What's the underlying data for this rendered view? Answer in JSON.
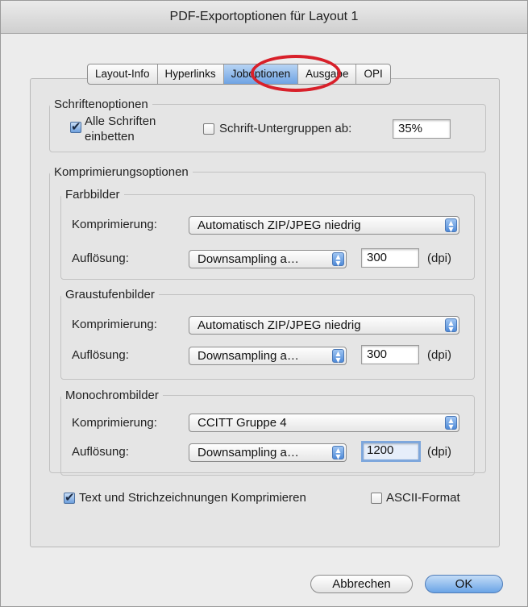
{
  "window": {
    "title": "PDF-Exportoptionen für Layout 1"
  },
  "tabs": [
    "Layout-Info",
    "Hyperlinks",
    "Joboptionen",
    "Ausgabe",
    "OPI"
  ],
  "fonts": {
    "legend": "Schriftenoptionen",
    "embed_all_line1": "Alle Schriften",
    "embed_all_line2": "einbetten",
    "embed_all_checked": true,
    "subset_label": "Schrift-Untergruppen ab:",
    "subset_checked": false,
    "subset_value": "35%"
  },
  "compression": {
    "legend": "Komprimierungsoptionen",
    "color": {
      "legend": "Farbbilder",
      "compression_label": "Komprimierung:",
      "compression_value": "Automatisch ZIP/JPEG niedrig",
      "resolution_label": "Auflösung:",
      "resolution_mode": "Downsampling a…",
      "dpi_value": "300",
      "dpi_unit": "(dpi)"
    },
    "gray": {
      "legend": "Graustufenbilder",
      "compression_label": "Komprimierung:",
      "compression_value": "Automatisch ZIP/JPEG niedrig",
      "resolution_label": "Auflösung:",
      "resolution_mode": "Downsampling a…",
      "dpi_value": "300",
      "dpi_unit": "(dpi)"
    },
    "mono": {
      "legend": "Monochrombilder",
      "compression_label": "Komprimierung:",
      "compression_value": "CCITT Gruppe 4",
      "resolution_label": "Auflösung:",
      "resolution_mode": "Downsampling a…",
      "dpi_value": "1200",
      "dpi_unit": "(dpi)"
    }
  },
  "options": {
    "compress_text_label": "Text und Strichzeichnungen Komprimieren",
    "compress_text_checked": true,
    "ascii_label": "ASCII-Format",
    "ascii_checked": false
  },
  "buttons": {
    "cancel": "Abbrechen",
    "ok": "OK"
  },
  "highlight_color": "#d8202a"
}
